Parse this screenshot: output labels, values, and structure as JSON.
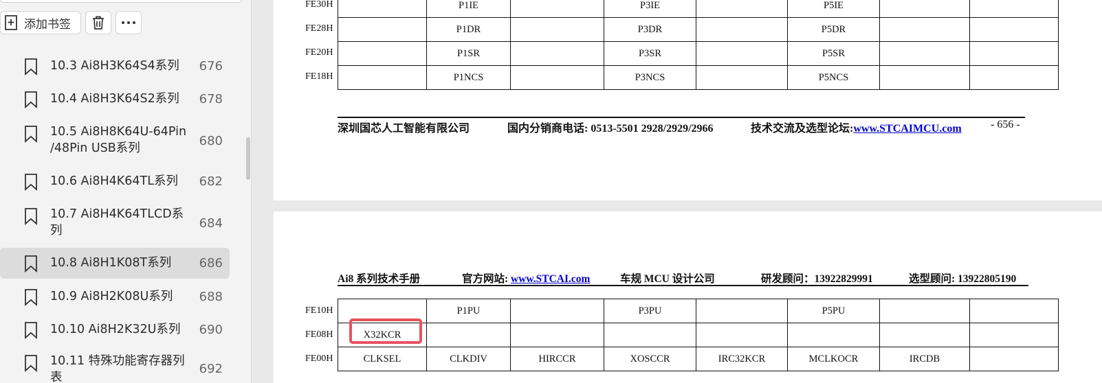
{
  "sidebar": {
    "toolbar": {
      "add_bookmark_label": "添加书签"
    },
    "bookmarks": [
      {
        "title": "10.3  Ai8H3K64S4系列",
        "page": "676"
      },
      {
        "title": "10.4  Ai8H3K64S2系列",
        "page": "678"
      },
      {
        "title": "10.5  Ai8H8K64U-64Pin /48Pin USB系列",
        "page": "680"
      },
      {
        "title": "10.6  Ai8H4K64TL系列",
        "page": "682"
      },
      {
        "title": "10.7  Ai8H4K64TLCD系列",
        "page": "684"
      },
      {
        "title": "10.8  Ai8H1K08T系列",
        "page": "686",
        "active": true
      },
      {
        "title": "10.9  Ai8H2K08U系列",
        "page": "688"
      },
      {
        "title": "10.10  Ai8H2K32U系列",
        "page": "690"
      },
      {
        "title": "10.11  特殊功能寄存器列表",
        "page": "692"
      }
    ]
  },
  "page1": {
    "rows": [
      {
        "addr": "FE30H",
        "cells": [
          "",
          "P1IE",
          "",
          "P3IE",
          "",
          "P5IE",
          "",
          ""
        ]
      },
      {
        "addr": "FE28H",
        "cells": [
          "",
          "P1DR",
          "",
          "P3DR",
          "",
          "P5DR",
          "",
          ""
        ]
      },
      {
        "addr": "FE20H",
        "cells": [
          "",
          "P1SR",
          "",
          "P3SR",
          "",
          "P5SR",
          "",
          ""
        ]
      },
      {
        "addr": "FE18H",
        "cells": [
          "",
          "P1NCS",
          "",
          "P3NCS",
          "",
          "P5NCS",
          "",
          ""
        ]
      }
    ],
    "footer": {
      "company": "深圳国芯人工智能有限公司",
      "phone": "国内分销商电话: 0513-5501 2928/2929/2966",
      "forum_label": "技术交流及选型论坛:",
      "forum_link": "www.STCAIMCU.com",
      "page_number": "- 656 -"
    }
  },
  "page2": {
    "header": {
      "manual": "Ai8 系列技术手册",
      "site_label": "官方网站: ",
      "site_link": "www.STCAI.com",
      "design": "车规 MCU 设计公司",
      "rd_advisor": "研发顾问：13922829991",
      "selection_advisor": "选型顾问: 13922805190"
    },
    "rows": [
      {
        "addr": "FE10H",
        "cells": [
          "",
          "P1PU",
          "",
          "P3PU",
          "",
          "P5PU",
          "",
          ""
        ]
      },
      {
        "addr": "FE08H",
        "cells": [
          "X32KCR",
          "",
          "",
          "",
          "",
          "",
          "",
          ""
        ]
      },
      {
        "addr": "FE00H",
        "cells": [
          "CLKSEL",
          "CLKDIV",
          "HIRCCR",
          "XOSCCR",
          "IRC32KCR",
          "MCLKOCR",
          "IRCDB",
          ""
        ]
      }
    ]
  },
  "colors": {
    "highlight": "#e8525f",
    "link": "#0000cc"
  }
}
